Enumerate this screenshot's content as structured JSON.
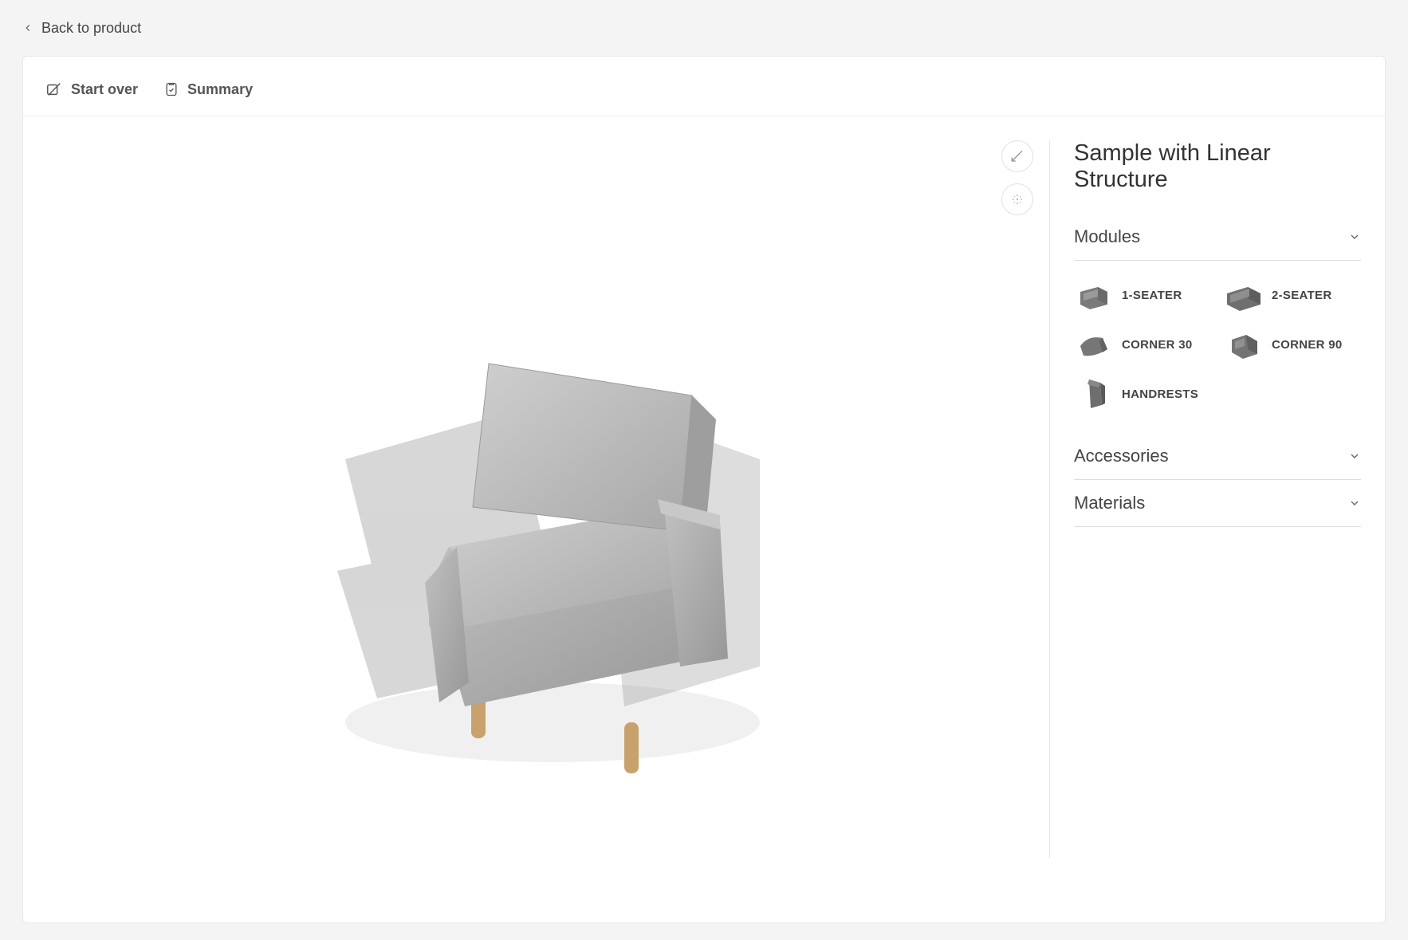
{
  "back_link": "Back to product",
  "toolbar": {
    "start_over": "Start over",
    "summary": "Summary"
  },
  "product_title": "Sample with Linear Structure",
  "sections": {
    "modules": {
      "title": "Modules",
      "expanded": true,
      "items": [
        {
          "label": "1-SEATER"
        },
        {
          "label": "2-SEATER"
        },
        {
          "label": "CORNER 30"
        },
        {
          "label": "CORNER 90"
        },
        {
          "label": "HANDRESTS"
        }
      ]
    },
    "accessories": {
      "title": "Accessories",
      "expanded": false
    },
    "materials": {
      "title": "Materials",
      "expanded": false
    }
  }
}
